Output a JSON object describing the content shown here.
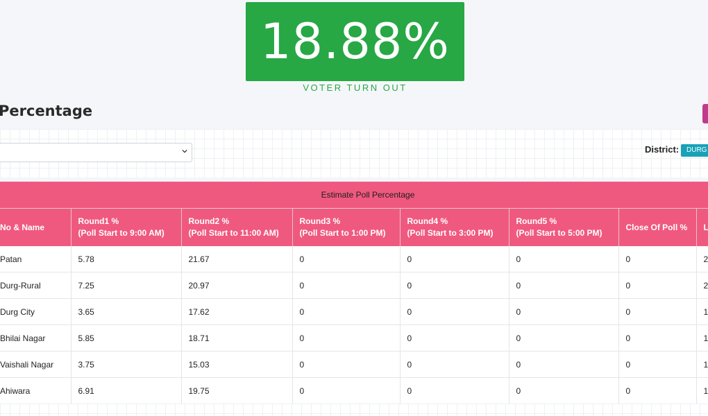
{
  "turnout": {
    "value": "18.88%",
    "label": "VOTER TURN OUT"
  },
  "section": {
    "title": "Percentage"
  },
  "filters": {
    "district_label": "District:",
    "district_value": "DURG"
  },
  "table": {
    "caption": "Estimate Poll Percentage",
    "headers": [
      {
        "line1": "No & Name",
        "line2": ""
      },
      {
        "line1": "Round1 %",
        "line2": "(Poll Start to 9:00 AM)"
      },
      {
        "line1": "Round2 %",
        "line2": "(Poll Start to 11:00 AM)"
      },
      {
        "line1": "Round3 %",
        "line2": "(Poll Start to 1:00 PM)"
      },
      {
        "line1": "Round4 %",
        "line2": "(Poll Start to 3:00 PM)"
      },
      {
        "line1": "Round5 %",
        "line2": "(Poll Start to 5:00 PM)"
      },
      {
        "line1": "Close Of Poll %",
        "line2": ""
      },
      {
        "line1": "L",
        "line2": ""
      }
    ],
    "rows": [
      [
        "Patan",
        "5.78",
        "21.67",
        "0",
        "0",
        "0",
        "0",
        "2"
      ],
      [
        "Durg-Rural",
        "7.25",
        "20.97",
        "0",
        "0",
        "0",
        "0",
        "2"
      ],
      [
        "Durg City",
        "3.65",
        "17.62",
        "0",
        "0",
        "0",
        "0",
        "1"
      ],
      [
        "Bhilai Nagar",
        "5.85",
        "18.71",
        "0",
        "0",
        "0",
        "0",
        "1"
      ],
      [
        "Vaishali Nagar",
        "3.75",
        "15.03",
        "0",
        "0",
        "0",
        "0",
        "1"
      ],
      [
        "Ahiwara",
        "6.91",
        "19.75",
        "0",
        "0",
        "0",
        "0",
        "1"
      ]
    ]
  },
  "colors": {
    "turnout_green": "#28a745",
    "table_header_pink": "#f0597f",
    "district_badge": "#17a2b8",
    "export_button": "#c03b8e"
  },
  "icons": {
    "select_arrow": "chevron-down-icon"
  }
}
